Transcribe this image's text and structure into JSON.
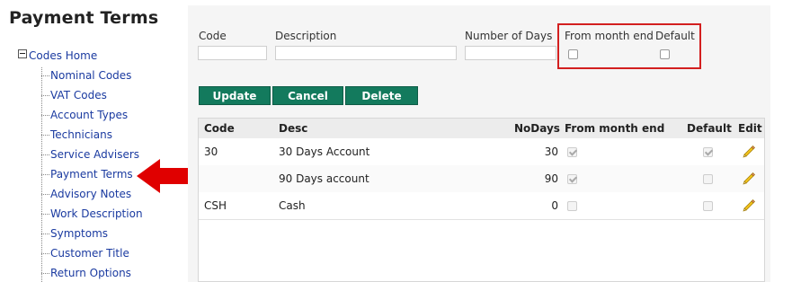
{
  "page": {
    "title": "Payment Terms"
  },
  "form": {
    "labels": {
      "code": "Code",
      "description": "Description",
      "number_of_days": "Number of Days",
      "from_month_end": "From month end",
      "default": "Default"
    },
    "values": {
      "code": "",
      "description": "",
      "number_of_days": ""
    },
    "buttons": {
      "update": "Update",
      "cancel": "Cancel",
      "delete": "Delete"
    }
  },
  "grid": {
    "headers": {
      "code": "Code",
      "desc": "Desc",
      "nodays": "NoDays",
      "from_month_end": "From month end",
      "default": "Default",
      "edit": "Edit"
    },
    "rows": [
      {
        "code": "30",
        "desc": "30 Days Account",
        "nodays": "30",
        "from_month_end": true,
        "default": true
      },
      {
        "code": "",
        "desc": "90 Days account",
        "nodays": "90",
        "from_month_end": true,
        "default": false
      },
      {
        "code": "CSH",
        "desc": "Cash",
        "nodays": "0",
        "from_month_end": false,
        "default": false
      }
    ]
  },
  "tree": {
    "root": "Codes Home",
    "items": [
      "Nominal Codes",
      "VAT Codes",
      "Account Types",
      "Technicians",
      "Service Advisers",
      "Payment Terms",
      "Advisory Notes",
      "Work Description",
      "Symptoms",
      "Customer Title",
      "Return Options"
    ]
  },
  "colors": {
    "button_bg": "#137a5d",
    "highlight_border": "#d31f1f",
    "arrow": "#e00000",
    "link": "#1a3aa0"
  },
  "icons": {
    "edit": "pencil-icon",
    "arrow": "red-arrow-icon",
    "tree_toggle": "minus-box-icon"
  }
}
